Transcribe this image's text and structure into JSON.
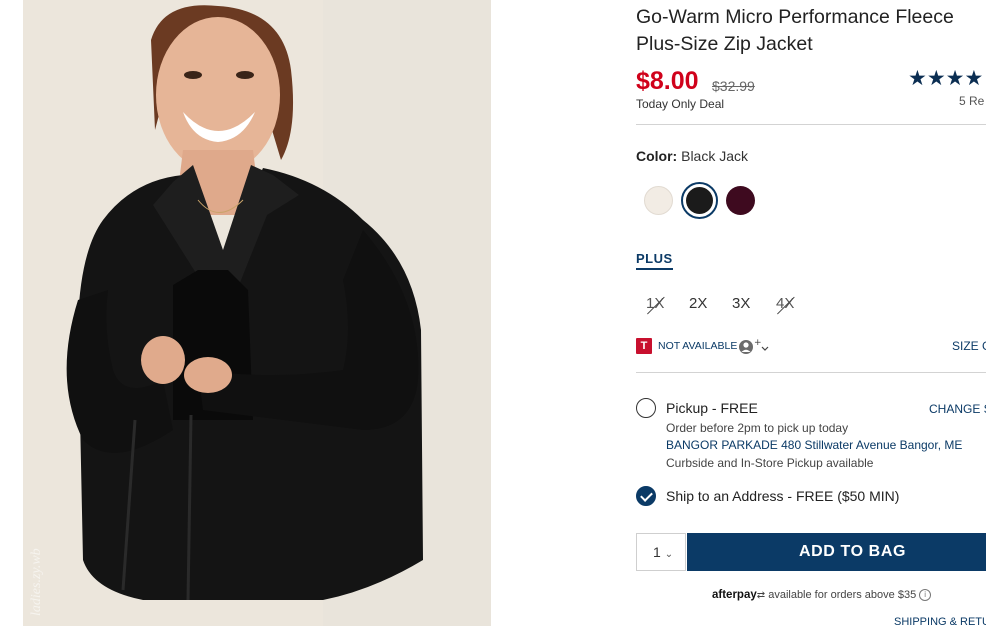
{
  "product": {
    "title_line1": "Go-Warm Micro Performance Fleece",
    "title_line2": "Plus-Size Zip Jacket",
    "price": "$8.00",
    "original_price": "$32.99",
    "deal_label": "Today Only Deal",
    "rating_stars": "★★★★",
    "rating_value": 4,
    "reviews_label": "5 Re",
    "image_watermark": "ladies.zy.wb"
  },
  "color": {
    "label": "Color:",
    "selected_name": "Black Jack",
    "swatches": [
      {
        "name": "cream-swatch",
        "hex": "#f2ece4"
      },
      {
        "name": "black-jack-swatch",
        "hex": "#1b1b1b",
        "selected": true
      },
      {
        "name": "burgundy-swatch",
        "hex": "#3e0a1f"
      }
    ]
  },
  "size": {
    "group_tab": "PLUS",
    "options": [
      {
        "label": "1X",
        "available": false
      },
      {
        "label": "2X",
        "available": true
      },
      {
        "label": "3X",
        "available": true
      },
      {
        "label": "4X",
        "available": false
      }
    ],
    "availability_text": "NOT AVAILABLE",
    "size_guide_link": "SIZE G"
  },
  "fulfillment": {
    "pickup_title": "Pickup - FREE",
    "change_store": "CHANGE S",
    "pickup_note": "Order before 2pm to pick up today",
    "store_address": "BANGOR PARKADE 480 Stillwater Avenue  Bangor, ME",
    "curbside_note": "Curbside and In-Store Pickup available",
    "ship_title": "Ship to an Address - FREE ($50 MIN)"
  },
  "cart": {
    "quantity": "1",
    "add_button": "ADD TO BAG"
  },
  "afterpay": {
    "logo": "afterpay",
    "text": "available for orders above $35"
  },
  "footer": {
    "shipping_link": "SHIPPING & RETU"
  },
  "colors": {
    "accent_navy": "#0b3a66",
    "sale_red": "#d0021b",
    "target_red": "#c8102e"
  }
}
